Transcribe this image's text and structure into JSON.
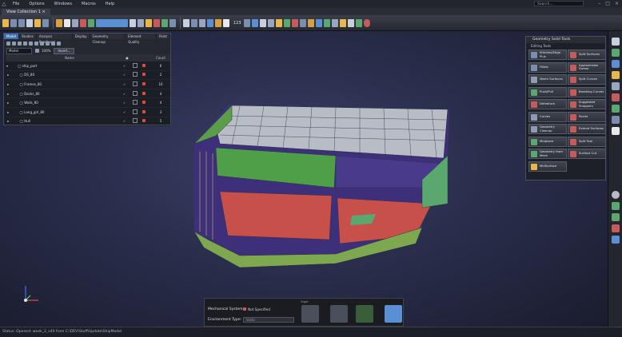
{
  "menubar": {
    "app_icon": "app-logo-icon",
    "items": [
      "File",
      "Options",
      "Windows",
      "Macros",
      "Help"
    ],
    "search_placeholder": "Search...",
    "window_controls": [
      "minimize-icon",
      "maximize-icon",
      "close-icon"
    ]
  },
  "tabs": [
    {
      "label": "View Collection 1"
    }
  ],
  "toolbar": {
    "zoom_value": "123"
  },
  "tree_panel": {
    "tabs": [
      "Model",
      "Studies",
      "Analysis Readiness",
      "Display",
      "Geometry Cleanup",
      "Element Quality",
      "Point"
    ],
    "filter_select": "Model",
    "opacity": "100%",
    "invert_button": "Invert...",
    "columns": {
      "name": "Name",
      "count": "Count"
    },
    "rows": [
      {
        "name": "ship_part",
        "count": "6"
      },
      {
        "name": "DS_80",
        "count": "2"
      },
      {
        "name": "Frames_80",
        "count": "16"
      },
      {
        "name": "Decks_80",
        "count": "4"
      },
      {
        "name": "Walls_80",
        "count": "4"
      },
      {
        "name": "Long_girl_80",
        "count": "3"
      },
      {
        "name": "Hull",
        "count": "5"
      }
    ]
  },
  "geometry_tools": {
    "title": "Geometry Solid Tools",
    "section": "Editing Tools",
    "buttons": [
      {
        "label": "Stitches/Edge Plus",
        "icon": "edge-icon",
        "color": "#7a8fb0"
      },
      {
        "label": "Split Surfaces",
        "icon": "split-icon",
        "color": "#c75a5a"
      },
      {
        "label": "Fillets",
        "icon": "fillet-icon",
        "color": "#7a8fb0"
      },
      {
        "label": "Approximate Sweep",
        "icon": "sweep-icon",
        "color": "#c75a5a"
      },
      {
        "label": "Warm Surfaces",
        "icon": "surface-icon",
        "color": "#8f9bb3"
      },
      {
        "label": "Split Curves",
        "icon": "curve-icon",
        "color": "#c75a5a"
      },
      {
        "label": "Push/Pull",
        "icon": "push-pull-icon",
        "color": "#5aa870"
      },
      {
        "label": "Breaking Curves",
        "icon": "break-icon",
        "color": "#c75a5a"
      },
      {
        "label": "Defeature",
        "icon": "defeature-icon",
        "color": "#c75a5a"
      },
      {
        "label": "Suggested Snappers",
        "icon": "snap-icon",
        "color": "#c75a5a"
      },
      {
        "label": "Curves",
        "icon": "curves-icon",
        "color": "#8f9bb3"
      },
      {
        "label": "Points",
        "icon": "points-icon",
        "color": "#c75a5a"
      },
      {
        "label": "Geometry Cleanup",
        "icon": "cleanup-icon",
        "color": "#8f9bb3"
      },
      {
        "label": "Extend Surfaces",
        "icon": "extend-icon",
        "color": "#c75a5a"
      },
      {
        "label": "Midplane",
        "icon": "midplane-icon",
        "color": "#5aa870"
      },
      {
        "label": "Split Tool",
        "icon": "split-tool-icon",
        "color": "#c75a5a"
      },
      {
        "label": "Geometry from Mesh",
        "icon": "mesh-icon",
        "color": "#5aa870"
      },
      {
        "label": "Surface Cut",
        "icon": "cut-icon",
        "color": "#c75a5a"
      },
      {
        "label": "MidSurface",
        "icon": "midsurface-icon",
        "color": "#e8b64a"
      }
    ]
  },
  "bottom_panel": {
    "title": "Vigel",
    "mechanical_system_label": "Mechanical System:",
    "mechanical_system_value": "Not Specified",
    "environment_type_label": "Environment Type:",
    "environment_type_value": "Static"
  },
  "status": {
    "text": "Status:  Opened: week_2_v40 from C:\\DEV\\Stuff\\Update\\ShipModel"
  }
}
